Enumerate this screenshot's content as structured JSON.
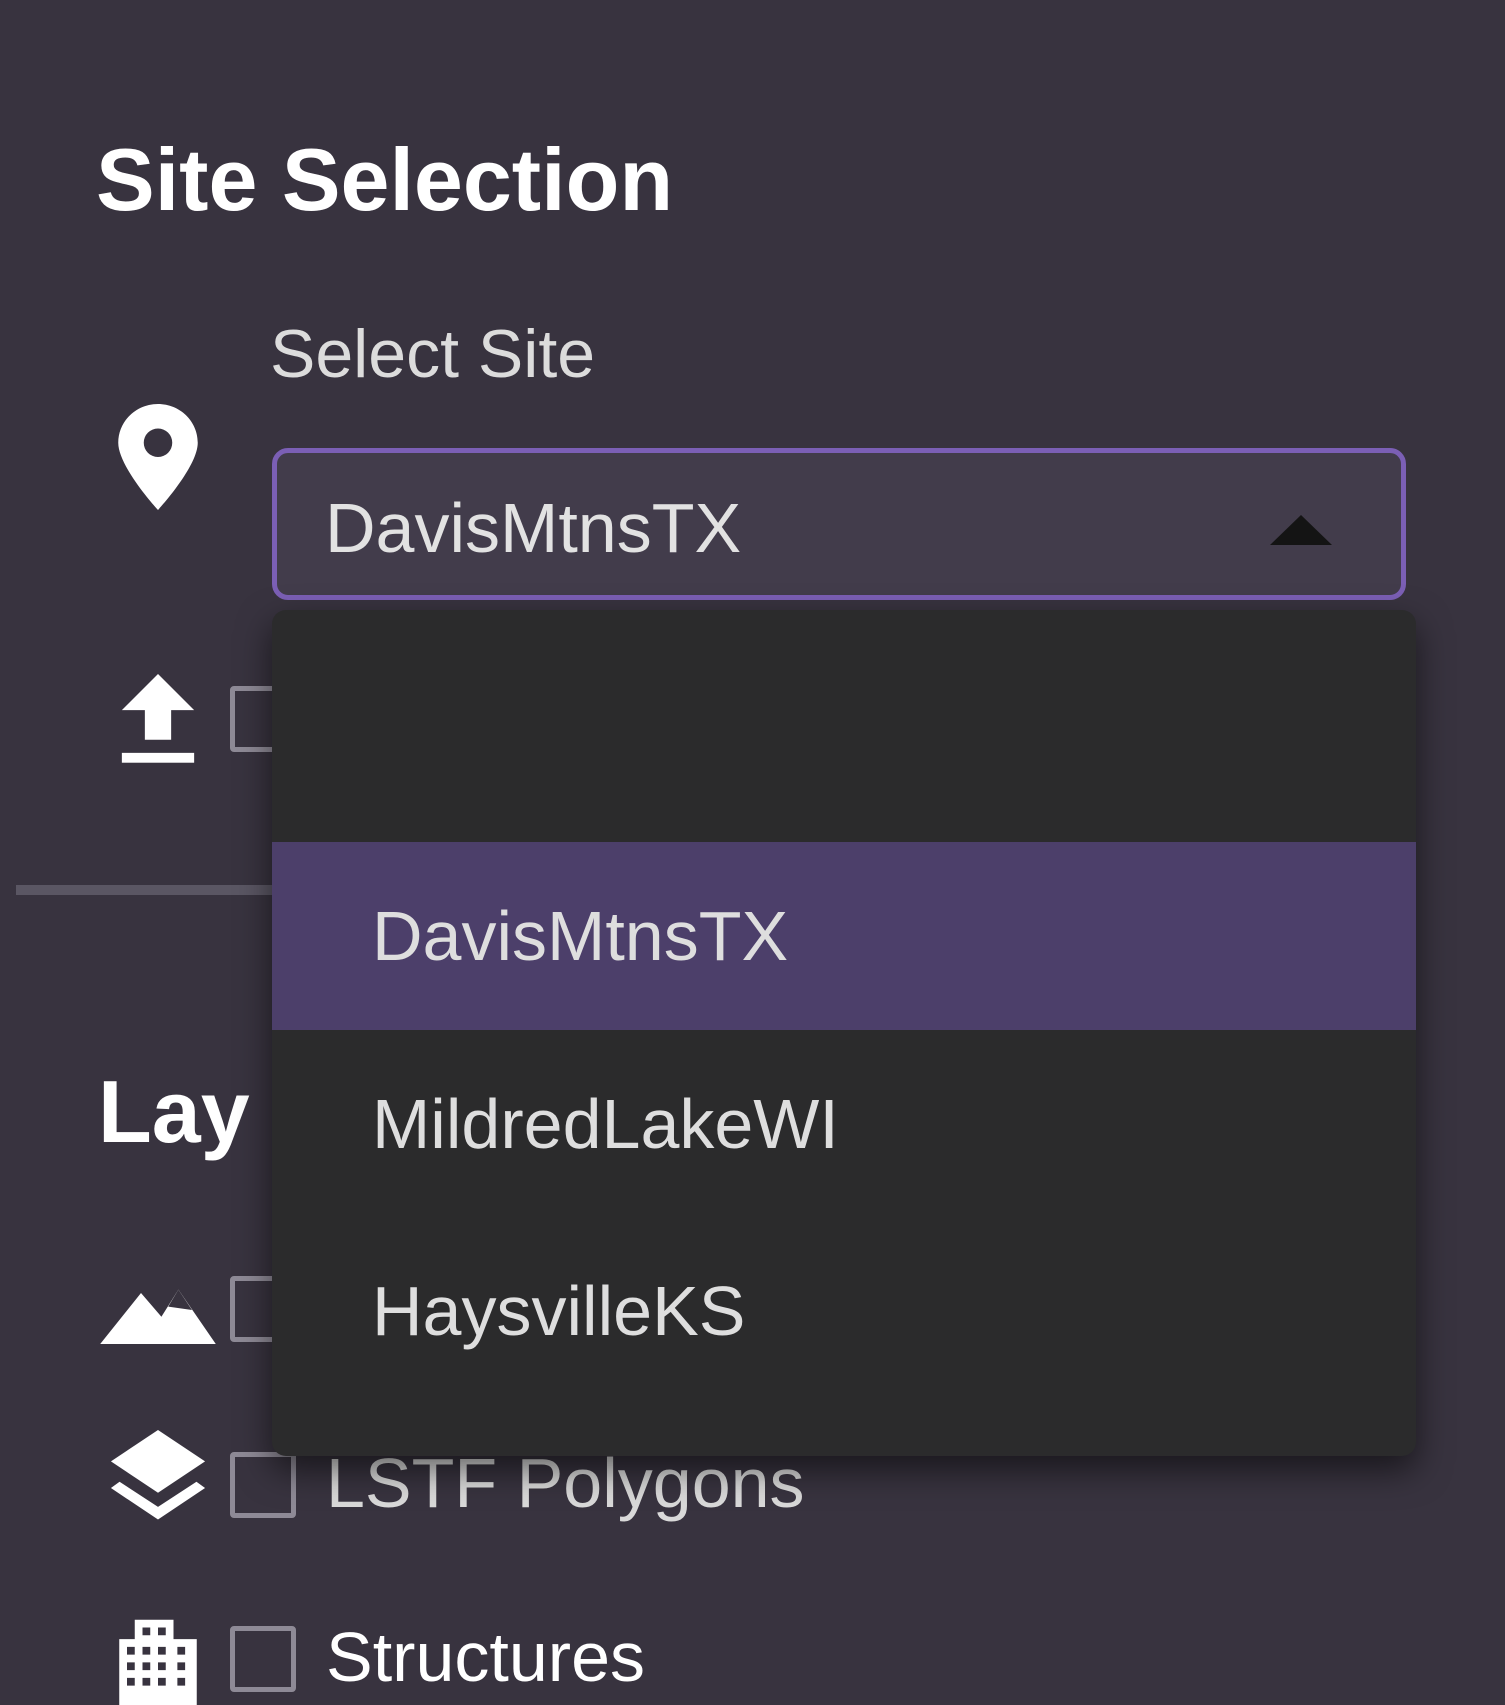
{
  "site_selection": {
    "title": "Site Selection",
    "select_label": "Select Site",
    "selected_value": "DavisMtnsTX",
    "dropdown_open": true,
    "options": [
      "",
      "DavisMtnsTX",
      "MildredLakeWI",
      "HaysvilleKS"
    ],
    "highlighted_option": "DavisMtnsTX"
  },
  "upload": {
    "icon": "upload-icon",
    "checked": false
  },
  "layers": {
    "title_visible": "Lay",
    "items": [
      {
        "icon": "terrain-icon",
        "label": "",
        "checked": false
      },
      {
        "icon": "layers-icon",
        "label": "LSTF Polygons",
        "checked": false
      },
      {
        "icon": "building-icon",
        "label": "Structures",
        "checked": false
      }
    ]
  },
  "colors": {
    "panel_background": "#38333f",
    "accent": "#7b5fb5",
    "highlight": "#4c3f6a",
    "dropdown_background": "#2b2b2c"
  }
}
